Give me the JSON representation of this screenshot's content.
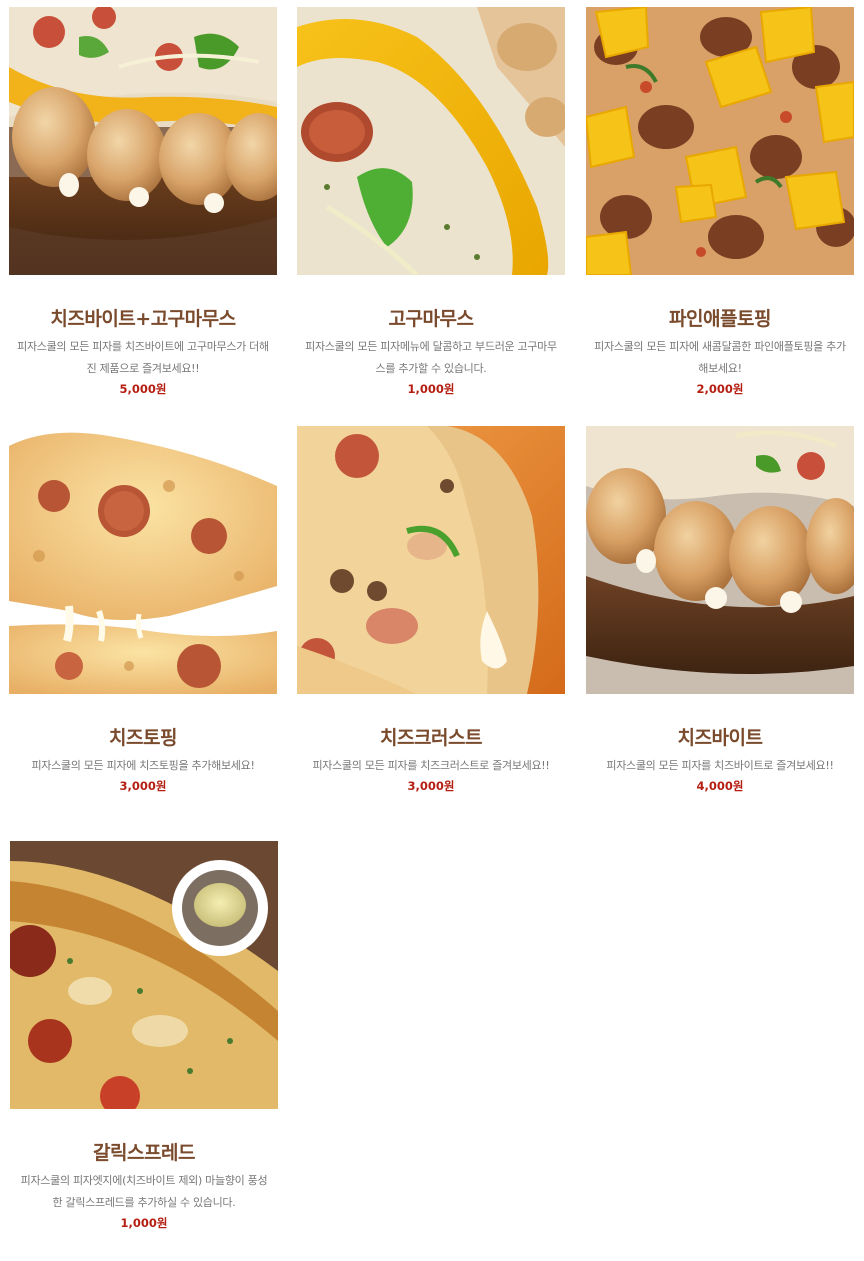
{
  "products": [
    {
      "name": "치즈바이트+고구마무스",
      "description": "피자스쿨의 모든 피자를 치즈바이트에 고구마무스가 더해진 제품으로 즐겨보세요!!",
      "price": "5,000원",
      "image": "cheese-bite-sweet-potato-mousse-photo"
    },
    {
      "name": "고구마무스",
      "description": "피자스쿨의 모든 피자메뉴에 달콤하고 부드러운 고구마무스를 추가할 수 있습니다.",
      "price": "1,000원",
      "image": "sweet-potato-mousse-photo"
    },
    {
      "name": "파인애플토핑",
      "description": "피자스쿨의 모든 피자에 새콤달콤한 파인애플토핑을 추가해보세요!",
      "price": "2,000원",
      "image": "pineapple-topping-photo"
    },
    {
      "name": "치즈토핑",
      "description": "피자스쿨의 모든 피자에 치즈토핑을 추가해보세요!",
      "price": "3,000원",
      "image": "cheese-topping-photo"
    },
    {
      "name": "치즈크러스트",
      "description": "피자스쿨의 모든 피자를 치즈크러스트로 즐겨보세요!!",
      "price": "3,000원",
      "image": "cheese-crust-photo"
    },
    {
      "name": "치즈바이트",
      "description": "피자스쿨의 모든 피자를 치즈바이트로 즐겨보세요!!",
      "price": "4,000원",
      "image": "cheese-bite-photo"
    },
    {
      "name": "갈릭스프레드",
      "description": "피자스쿨의 피자엣지에(치즈바이트 제외) 마늘향이 풍성한 갈릭스프레드를 추가하실 수 있습니다.",
      "price": "1,000원",
      "image": "garlic-spread-photo"
    }
  ],
  "colors": {
    "title": "#7a4a2c",
    "description": "#777777",
    "price": "#b51f12"
  }
}
